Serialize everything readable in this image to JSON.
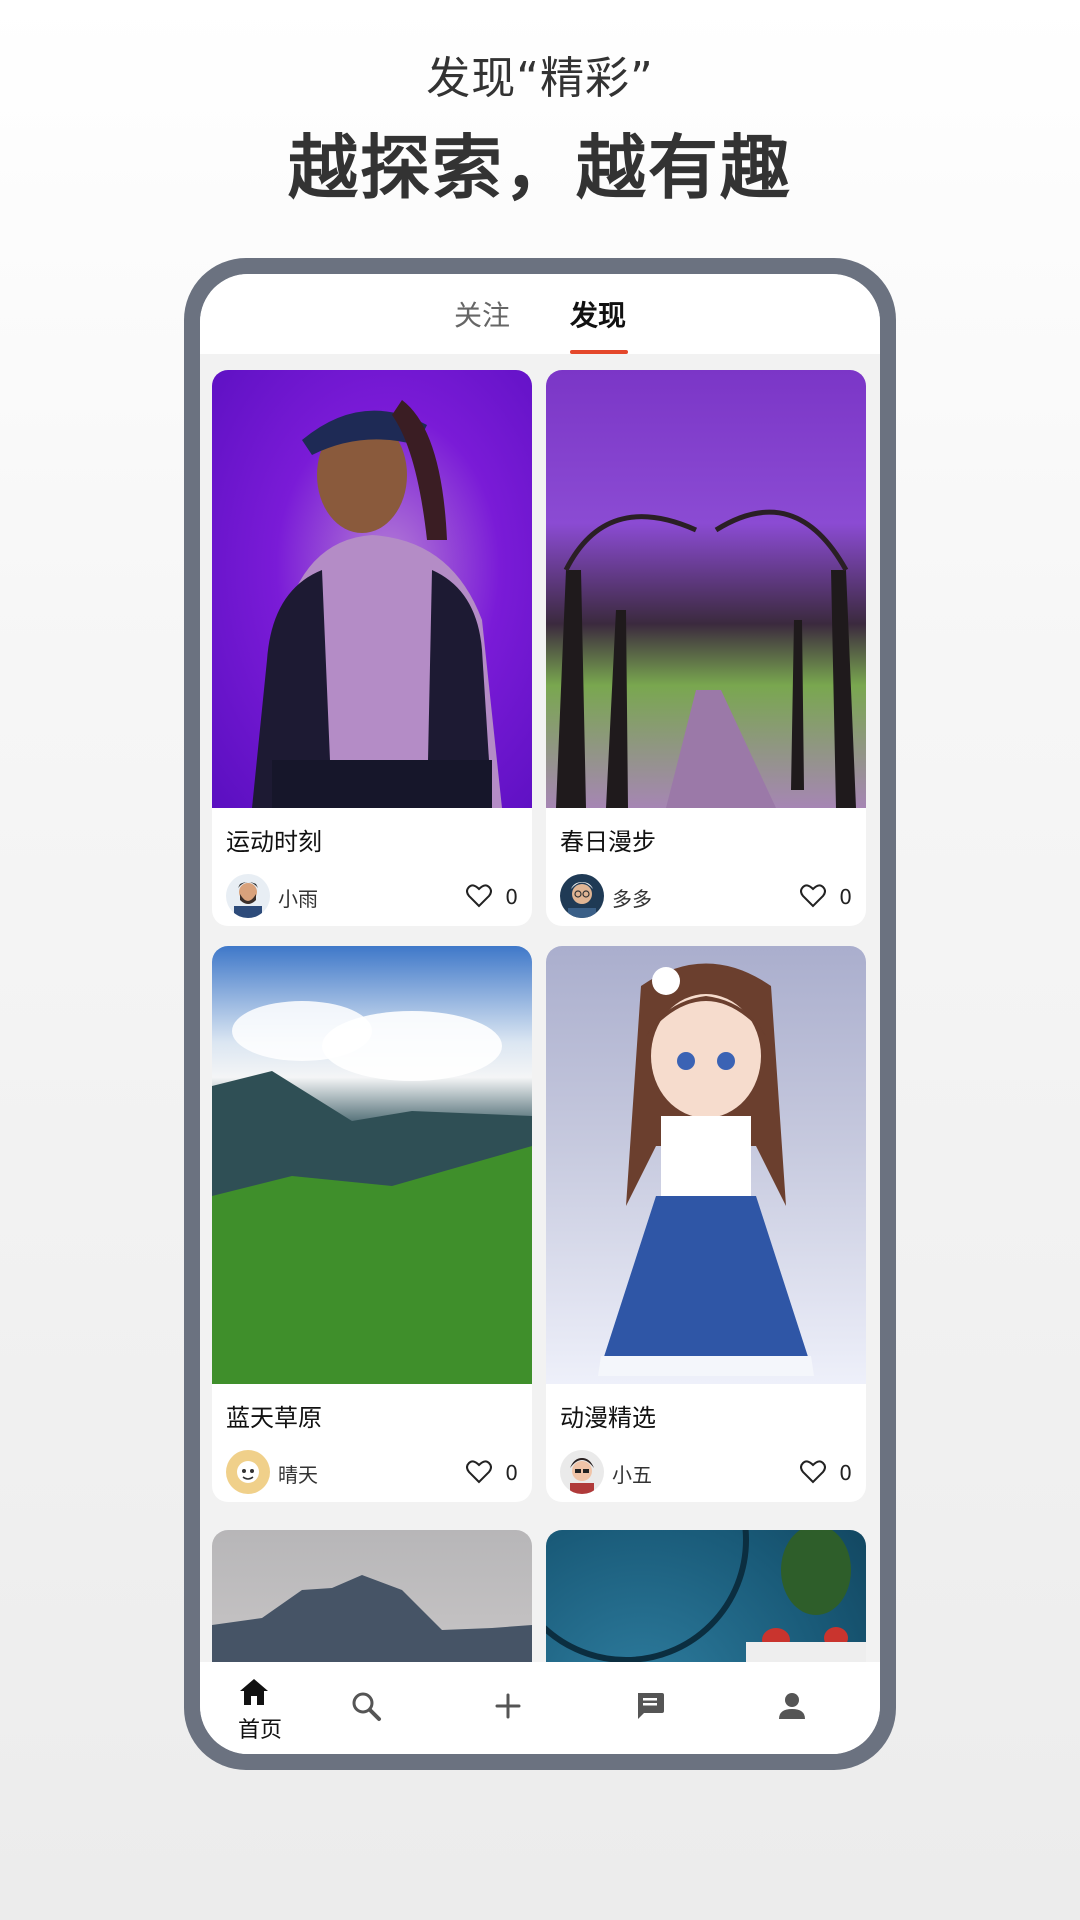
{
  "promo": {
    "subtitle": "发现“精彩”",
    "title": "越探索，越有趣"
  },
  "tabs": {
    "follow": "关注",
    "discover": "发现",
    "active": "discover"
  },
  "feed": [
    {
      "title": "运动时刻",
      "author": "小雨",
      "likes": "0",
      "image": "girl-in-purple-hoodie"
    },
    {
      "title": "春日漫步",
      "author": "多多",
      "likes": "0",
      "image": "purple-tree-avenue"
    },
    {
      "title": "蓝天草原",
      "author": "晴天",
      "likes": "0",
      "image": "green-meadow-mountains"
    },
    {
      "title": "动漫精选",
      "author": "小五",
      "likes": "0",
      "image": "anime-girl-blue-dress"
    },
    {
      "title": "",
      "author": "",
      "likes": "",
      "image": "misty-mountains"
    },
    {
      "title": "",
      "author": "",
      "likes": "",
      "image": "blue-plate-strawberries"
    }
  ],
  "bottom_nav": {
    "home_label": "首页",
    "items": [
      "home-icon",
      "search-icon",
      "add-icon",
      "message-icon",
      "profile-icon"
    ]
  },
  "colors": {
    "accent": "#e4472b",
    "phone_frame": "#6b7280",
    "text": "#222222"
  }
}
